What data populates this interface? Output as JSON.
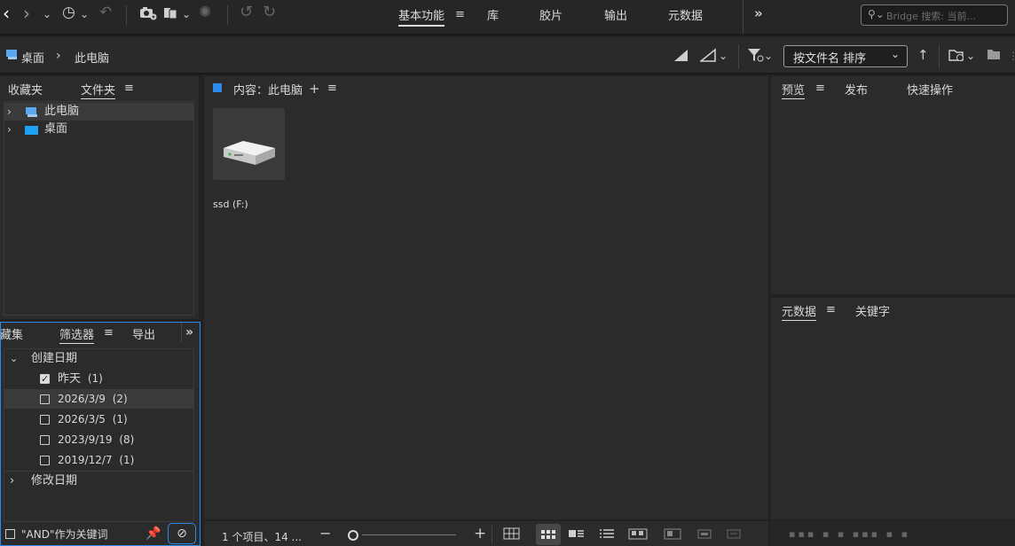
{
  "top": {
    "workspaces": [
      "基本功能",
      "库",
      "胶片",
      "输出",
      "元数据"
    ],
    "active_workspace": "基本功能",
    "search_placeholder": "Bridge 搜索: 当前..."
  },
  "path": {
    "crumbs": [
      "桌面",
      "此电脑"
    ],
    "sort_label": "按文件名 排序"
  },
  "left": {
    "tabs": [
      "收藏夹",
      "文件夹"
    ],
    "active_tab": "文件夹",
    "tree": [
      {
        "label": "此电脑",
        "icon": "computer-icon"
      },
      {
        "label": "桌面",
        "icon": "desktop-folder-icon"
      }
    ]
  },
  "filter": {
    "tabs": [
      "藏集",
      "筛选器",
      "导出"
    ],
    "active_tab": "筛选器",
    "group1": "创建日期",
    "items": [
      {
        "label": "昨天",
        "count": "(1)",
        "checked": true
      },
      {
        "label": "2026/3/9",
        "count": "(2)",
        "checked": false
      },
      {
        "label": "2026/3/5",
        "count": "(1)",
        "checked": false
      },
      {
        "label": "2023/9/19",
        "count": "(8)",
        "checked": false
      },
      {
        "label": "2019/12/7",
        "count": "(1)",
        "checked": false
      }
    ],
    "group2": "修改日期",
    "and_label": "\"AND\"作为关键词"
  },
  "content": {
    "title": "内容：此电脑",
    "items": [
      {
        "label": "ssd (F:)",
        "icon": "drive-icon"
      }
    ],
    "status": "1 个项目、14 ..."
  },
  "right": {
    "top_tabs": [
      "预览",
      "发布",
      "快速操作"
    ],
    "top_active": "预览",
    "bottom_tabs": [
      "元数据",
      "关键字"
    ],
    "bottom_active": "元数据"
  },
  "colors": {
    "accent": "#2d8ceb",
    "panel": "#2b2b2b",
    "chrome": "#262626"
  }
}
